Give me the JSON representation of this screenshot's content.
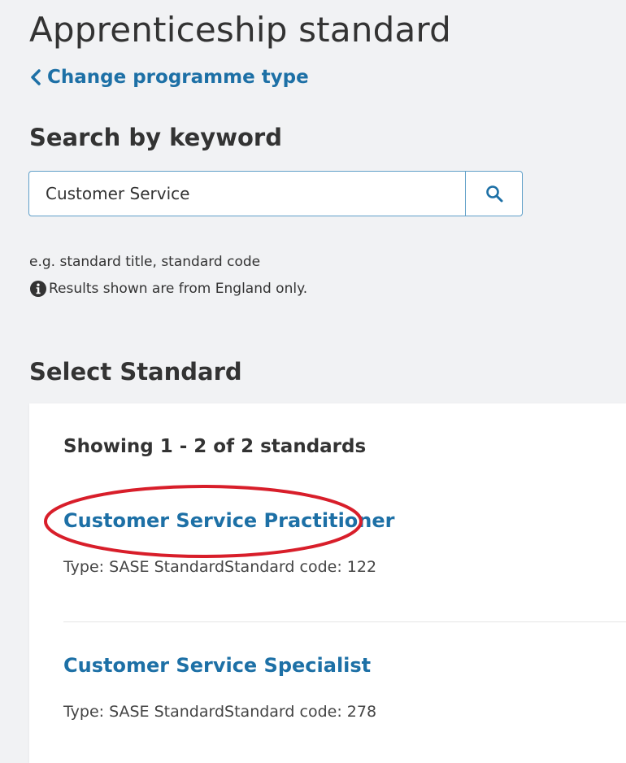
{
  "page": {
    "title": "Apprenticeship standard",
    "back_link": "Change programme type"
  },
  "search": {
    "heading": "Search by keyword",
    "value": "Customer Service",
    "button_icon": "search-icon",
    "hint": "e.g. standard title, standard code",
    "info_icon": "info-icon",
    "info_text": "Results shown are from England only."
  },
  "results": {
    "heading": "Select Standard",
    "count_text": "Showing 1 - 2 of 2 standards",
    "items": [
      {
        "title": "Customer Service Practitioner",
        "meta": "Type: SASE StandardStandard code: 122",
        "highlighted": true
      },
      {
        "title": "Customer Service Specialist",
        "meta": "Type: SASE StandardStandard code: 278",
        "highlighted": false
      }
    ]
  },
  "colors": {
    "link": "#1d70a6",
    "background": "#f1f2f4",
    "highlight": "#d81e2a",
    "input_border": "#5f9fc8"
  }
}
